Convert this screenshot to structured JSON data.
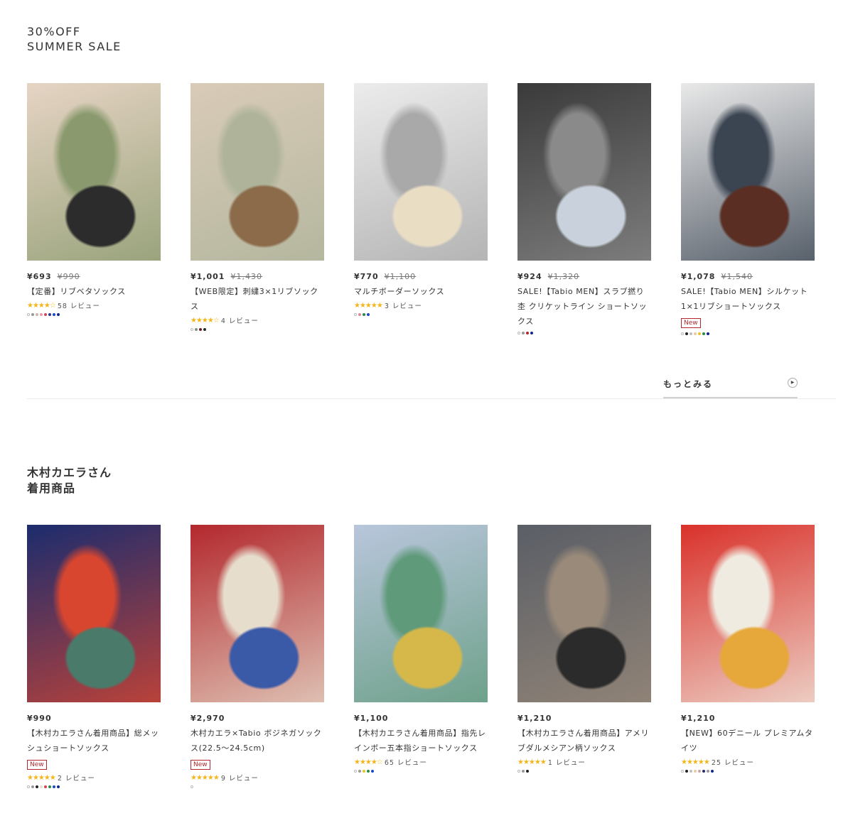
{
  "section1": {
    "title_line1": "30%OFF",
    "title_line2": "SUMMER SALE",
    "more_label": "もっとみる",
    "products": [
      {
        "price": "¥693",
        "orig": "¥990",
        "name": "【定番】リブベタソックス",
        "stars": "★★★★☆",
        "review": "58 レビュー",
        "badge": "",
        "colors": [
          "#ffffff",
          "#999999",
          "#c8b9a6",
          "#e89aa8",
          "#d1455a",
          "#2a3a8c",
          "#1e49c2",
          "#12288a"
        ],
        "img": [
          "#e6d4c4",
          "#8a9a6e",
          "#2c2c2c"
        ]
      },
      {
        "price": "¥1,001",
        "orig": "¥1,430",
        "name": "【WEB限定】刺繍3×1リブソックス",
        "stars": "★★★★☆",
        "review": "4 レビュー",
        "badge": "",
        "colors": [
          "#ffffff",
          "#8a8a8a",
          "#6a1f23",
          "#2b2b2b"
        ],
        "img": [
          "#d9cbb8",
          "#aeb39a",
          "#8b6b4a"
        ]
      },
      {
        "price": "¥770",
        "orig": "¥1,100",
        "name": "マルチボーダーソックス",
        "stars": "★★★★★",
        "review": "3 レビュー",
        "badge": "",
        "colors": [
          "#ffffff",
          "#d48a9a",
          "#2a8a4a",
          "#1e49c2"
        ],
        "img": [
          "#ececec",
          "#a9a9a9",
          "#e9ddc4"
        ]
      },
      {
        "price": "¥924",
        "orig": "¥1,320",
        "name": "SALE!【Tabio MEN】スラブ撚り杢 クリケットライン ショートソックス",
        "stars": "",
        "review": "",
        "badge": "",
        "colors": [
          "#ffffff",
          "#999999",
          "#b3282d",
          "#12288a"
        ],
        "img": [
          "#3a3a3a",
          "#8a8a8a",
          "#c9d2dc"
        ]
      },
      {
        "price": "¥1,078",
        "orig": "¥1,540",
        "name": "SALE!【Tabio MEN】シルケット1×1リブショートソックス",
        "stars": "",
        "review": "",
        "badge": "New",
        "colors": [
          "#ffffff",
          "#222222",
          "#bfbfbf",
          "#e8c9a4",
          "#e7c42a",
          "#2a8a4a",
          "#12288a"
        ],
        "img": [
          "#e9e9e9",
          "#3b4552",
          "#5a2e22"
        ]
      }
    ]
  },
  "section2": {
    "title_line1": "木村カエラさん",
    "title_line2": "着用商品",
    "products": [
      {
        "price": "¥990",
        "orig": "",
        "name": "【木村カエラさん着用商品】総メッシュショートソックス",
        "stars": "★★★★★",
        "review": "2 レビュー",
        "badge": "New",
        "colors": [
          "#ffffff",
          "#999999",
          "#222222",
          "#e8e0c8",
          "#d1455a",
          "#2a8a4a",
          "#1e49c2",
          "#12288a"
        ],
        "img": [
          "#1b2c6e",
          "#d9462f",
          "#4a7a6a"
        ]
      },
      {
        "price": "¥2,970",
        "orig": "",
        "name": "木村カエラ×Tabio ボジネガソックス(22.5〜24.5cm)",
        "stars": "★★★★★",
        "review": "9 レビュー",
        "badge": "New",
        "colors": [
          "#ffffff"
        ],
        "img": [
          "#b3282d",
          "#e6ddcc",
          "#3a5aa8"
        ]
      },
      {
        "price": "¥1,100",
        "orig": "",
        "name": "【木村カエラさん着用商品】指先レインボー五本指ショートソックス",
        "stars": "★★★★☆",
        "review": "65 レビュー",
        "badge": "",
        "colors": [
          "#ffffff",
          "#999999",
          "#e7c42a",
          "#2a8a4a",
          "#1e49c2"
        ],
        "img": [
          "#b9c6dc",
          "#5f9a7a",
          "#d6b84a"
        ]
      },
      {
        "price": "¥1,210",
        "orig": "",
        "name": "【木村カエラさん着用商品】アメリブダルメシアン柄ソックス",
        "stars": "★★★★★",
        "review": "1 レビュー",
        "badge": "",
        "colors": [
          "#ffffff",
          "#999999",
          "#222222"
        ],
        "img": [
          "#5a5e66",
          "#9a8a7a",
          "#2b2b2b"
        ]
      },
      {
        "price": "¥1,210",
        "orig": "",
        "name": "【NEW】60デニール プレミアムタイツ",
        "stars": "★★★★★",
        "review": "25 レビュー",
        "badge": "",
        "colors": [
          "#ffffff",
          "#222222",
          "#bfbfbf",
          "#e8c9a4",
          "#c8a8a0",
          "#2a2a6a",
          "#999999",
          "#12288a"
        ],
        "img": [
          "#d9312a",
          "#f0ebe0",
          "#e6a83a"
        ]
      }
    ]
  }
}
